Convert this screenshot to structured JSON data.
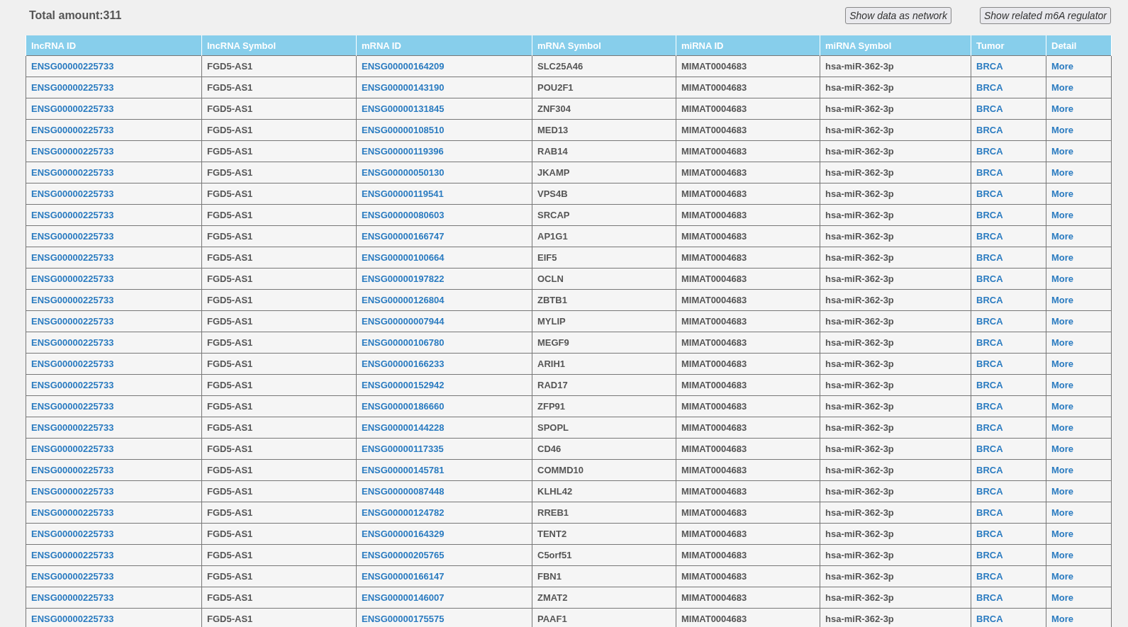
{
  "total_amount": "Total amount:311",
  "buttons": [
    "Show data as network",
    "Show related m6A regulator"
  ],
  "table": {
    "columns": [
      {
        "label": "lncRNA ID",
        "kind": "link"
      },
      {
        "label": "lncRNA Symbol",
        "kind": "text"
      },
      {
        "label": "mRNA ID",
        "kind": "link"
      },
      {
        "label": "mRNA Symbol",
        "kind": "text"
      },
      {
        "label": "miRNA ID",
        "kind": "text"
      },
      {
        "label": "miRNA Symbol",
        "kind": "text"
      },
      {
        "label": "Tumor",
        "kind": "link"
      },
      {
        "label": "Detail",
        "kind": "link"
      }
    ],
    "rows": [
      [
        "ENSG00000225733",
        "FGD5-AS1",
        "ENSG00000164209",
        "SLC25A46",
        "MIMAT0004683",
        "hsa-miR-362-3p",
        "BRCA",
        "More"
      ],
      [
        "ENSG00000225733",
        "FGD5-AS1",
        "ENSG00000143190",
        "POU2F1",
        "MIMAT0004683",
        "hsa-miR-362-3p",
        "BRCA",
        "More"
      ],
      [
        "ENSG00000225733",
        "FGD5-AS1",
        "ENSG00000131845",
        "ZNF304",
        "MIMAT0004683",
        "hsa-miR-362-3p",
        "BRCA",
        "More"
      ],
      [
        "ENSG00000225733",
        "FGD5-AS1",
        "ENSG00000108510",
        "MED13",
        "MIMAT0004683",
        "hsa-miR-362-3p",
        "BRCA",
        "More"
      ],
      [
        "ENSG00000225733",
        "FGD5-AS1",
        "ENSG00000119396",
        "RAB14",
        "MIMAT0004683",
        "hsa-miR-362-3p",
        "BRCA",
        "More"
      ],
      [
        "ENSG00000225733",
        "FGD5-AS1",
        "ENSG00000050130",
        "JKAMP",
        "MIMAT0004683",
        "hsa-miR-362-3p",
        "BRCA",
        "More"
      ],
      [
        "ENSG00000225733",
        "FGD5-AS1",
        "ENSG00000119541",
        "VPS4B",
        "MIMAT0004683",
        "hsa-miR-362-3p",
        "BRCA",
        "More"
      ],
      [
        "ENSG00000225733",
        "FGD5-AS1",
        "ENSG00000080603",
        "SRCAP",
        "MIMAT0004683",
        "hsa-miR-362-3p",
        "BRCA",
        "More"
      ],
      [
        "ENSG00000225733",
        "FGD5-AS1",
        "ENSG00000166747",
        "AP1G1",
        "MIMAT0004683",
        "hsa-miR-362-3p",
        "BRCA",
        "More"
      ],
      [
        "ENSG00000225733",
        "FGD5-AS1",
        "ENSG00000100664",
        "EIF5",
        "MIMAT0004683",
        "hsa-miR-362-3p",
        "BRCA",
        "More"
      ],
      [
        "ENSG00000225733",
        "FGD5-AS1",
        "ENSG00000197822",
        "OCLN",
        "MIMAT0004683",
        "hsa-miR-362-3p",
        "BRCA",
        "More"
      ],
      [
        "ENSG00000225733",
        "FGD5-AS1",
        "ENSG00000126804",
        "ZBTB1",
        "MIMAT0004683",
        "hsa-miR-362-3p",
        "BRCA",
        "More"
      ],
      [
        "ENSG00000225733",
        "FGD5-AS1",
        "ENSG00000007944",
        "MYLIP",
        "MIMAT0004683",
        "hsa-miR-362-3p",
        "BRCA",
        "More"
      ],
      [
        "ENSG00000225733",
        "FGD5-AS1",
        "ENSG00000106780",
        "MEGF9",
        "MIMAT0004683",
        "hsa-miR-362-3p",
        "BRCA",
        "More"
      ],
      [
        "ENSG00000225733",
        "FGD5-AS1",
        "ENSG00000166233",
        "ARIH1",
        "MIMAT0004683",
        "hsa-miR-362-3p",
        "BRCA",
        "More"
      ],
      [
        "ENSG00000225733",
        "FGD5-AS1",
        "ENSG00000152942",
        "RAD17",
        "MIMAT0004683",
        "hsa-miR-362-3p",
        "BRCA",
        "More"
      ],
      [
        "ENSG00000225733",
        "FGD5-AS1",
        "ENSG00000186660",
        "ZFP91",
        "MIMAT0004683",
        "hsa-miR-362-3p",
        "BRCA",
        "More"
      ],
      [
        "ENSG00000225733",
        "FGD5-AS1",
        "ENSG00000144228",
        "SPOPL",
        "MIMAT0004683",
        "hsa-miR-362-3p",
        "BRCA",
        "More"
      ],
      [
        "ENSG00000225733",
        "FGD5-AS1",
        "ENSG00000117335",
        "CD46",
        "MIMAT0004683",
        "hsa-miR-362-3p",
        "BRCA",
        "More"
      ],
      [
        "ENSG00000225733",
        "FGD5-AS1",
        "ENSG00000145781",
        "COMMD10",
        "MIMAT0004683",
        "hsa-miR-362-3p",
        "BRCA",
        "More"
      ],
      [
        "ENSG00000225733",
        "FGD5-AS1",
        "ENSG00000087448",
        "KLHL42",
        "MIMAT0004683",
        "hsa-miR-362-3p",
        "BRCA",
        "More"
      ],
      [
        "ENSG00000225733",
        "FGD5-AS1",
        "ENSG00000124782",
        "RREB1",
        "MIMAT0004683",
        "hsa-miR-362-3p",
        "BRCA",
        "More"
      ],
      [
        "ENSG00000225733",
        "FGD5-AS1",
        "ENSG00000164329",
        "TENT2",
        "MIMAT0004683",
        "hsa-miR-362-3p",
        "BRCA",
        "More"
      ],
      [
        "ENSG00000225733",
        "FGD5-AS1",
        "ENSG00000205765",
        "C5orf51",
        "MIMAT0004683",
        "hsa-miR-362-3p",
        "BRCA",
        "More"
      ],
      [
        "ENSG00000225733",
        "FGD5-AS1",
        "ENSG00000166147",
        "FBN1",
        "MIMAT0004683",
        "hsa-miR-362-3p",
        "BRCA",
        "More"
      ],
      [
        "ENSG00000225733",
        "FGD5-AS1",
        "ENSG00000146007",
        "ZMAT2",
        "MIMAT0004683",
        "hsa-miR-362-3p",
        "BRCA",
        "More"
      ],
      [
        "ENSG00000225733",
        "FGD5-AS1",
        "ENSG00000175575",
        "PAAF1",
        "MIMAT0004683",
        "hsa-miR-362-3p",
        "BRCA",
        "More"
      ]
    ]
  }
}
